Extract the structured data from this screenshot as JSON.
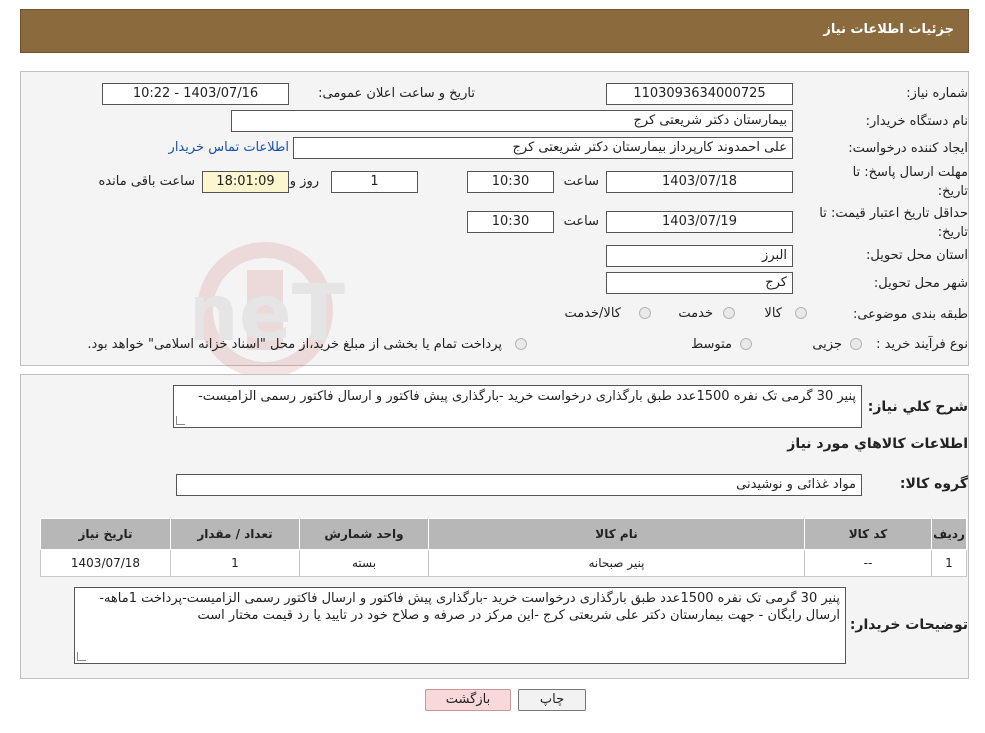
{
  "header": {
    "title": "جزئیات اطلاعات نیاز"
  },
  "form": {
    "need_number_label": "شماره نیاز:",
    "need_number": "1103093634000725",
    "announce_label": "تاریخ و ساعت اعلان عمومی:",
    "announce_value": "1403/07/16 - 10:22",
    "buyer_org_label": "نام دستگاه خریدار:",
    "buyer_org": "بیمارستان دکتر شریعتی کرج",
    "creator_label": "ایجاد کننده درخواست:",
    "creator": "علی احمدوند کارپرداز بیمارستان دکتر شریعتی کرج",
    "contact_link": "اطلاعات تماس خریدار",
    "reply_deadline_label_1": "مهلت ارسال پاسخ: تا",
    "reply_deadline_label_2": "تاریخ:",
    "reply_date": "1403/07/18",
    "time_label": "ساعت",
    "reply_time": "10:30",
    "days_value": "1",
    "days_label": "روز و",
    "remaining_time": "18:01:09",
    "remaining_label": "ساعت باقی مانده",
    "validity_label_1": "حداقل تاریخ اعتبار قیمت: تا",
    "validity_label_2": "تاریخ:",
    "validity_date": "1403/07/19",
    "validity_time": "10:30",
    "province_label": "استان محل تحویل:",
    "province": "البرز",
    "city_label": "شهر محل تحویل:",
    "city": "کرج",
    "category_label": "طبقه بندی موضوعی:",
    "category_options": [
      "کالا",
      "خدمت",
      "کالا/خدمت"
    ],
    "process_label": "نوع فرآیند خرید :",
    "process_options": [
      "جزیی",
      "متوسط"
    ],
    "payment_note": "پرداخت تمام یا بخشی از مبلغ خرید،از محل \"اسناد خزانه اسلامی\" خواهد بود."
  },
  "details": {
    "desc_label": "شرح کلي نياز:",
    "desc_value": "پنیر 30 گرمی تک نفره 1500عدد  طبق بارگذاری درخواست خرید -بارگذاری پیش فاکتور و ارسال فاکتور رسمی الزامیست-",
    "goods_info_title": "اطلاعات کالاهاي مورد نياز",
    "goods_group_label": "گروه کالا:",
    "goods_group": "مواد غذائی و نوشیدنی"
  },
  "table": {
    "headers": [
      "رديف",
      "کد کالا",
      "نام کالا",
      "واحد شمارش",
      "تعداد / مقدار",
      "تاریخ نیاز"
    ],
    "rows": [
      [
        "1",
        "--",
        "پنیر صبحانه",
        "بسته",
        "1",
        "1403/07/18"
      ]
    ]
  },
  "buyer_notes": {
    "label": "توضیحات خریدار:",
    "value": "پنیر 30 گرمی تک نفره 1500عدد  طبق بارگذاری درخواست خرید -بارگذاری پیش فاکتور و ارسال فاکتور رسمی الزامیست-پرداخت 1ماهه-ارسال رایگان - جهت بیمارستان دکتر علی شریعتی کرج -این مرکز در صرفه و صلاح خود در تایید یا رد قیمت مختار است"
  },
  "buttons": {
    "print": "چاپ",
    "back": "بازگشت"
  },
  "colors": {
    "header_bg": "#8b6b3e",
    "table_header": "#b7b7b7",
    "back_button": "#f8d8d8",
    "link": "#1a4fb3"
  }
}
